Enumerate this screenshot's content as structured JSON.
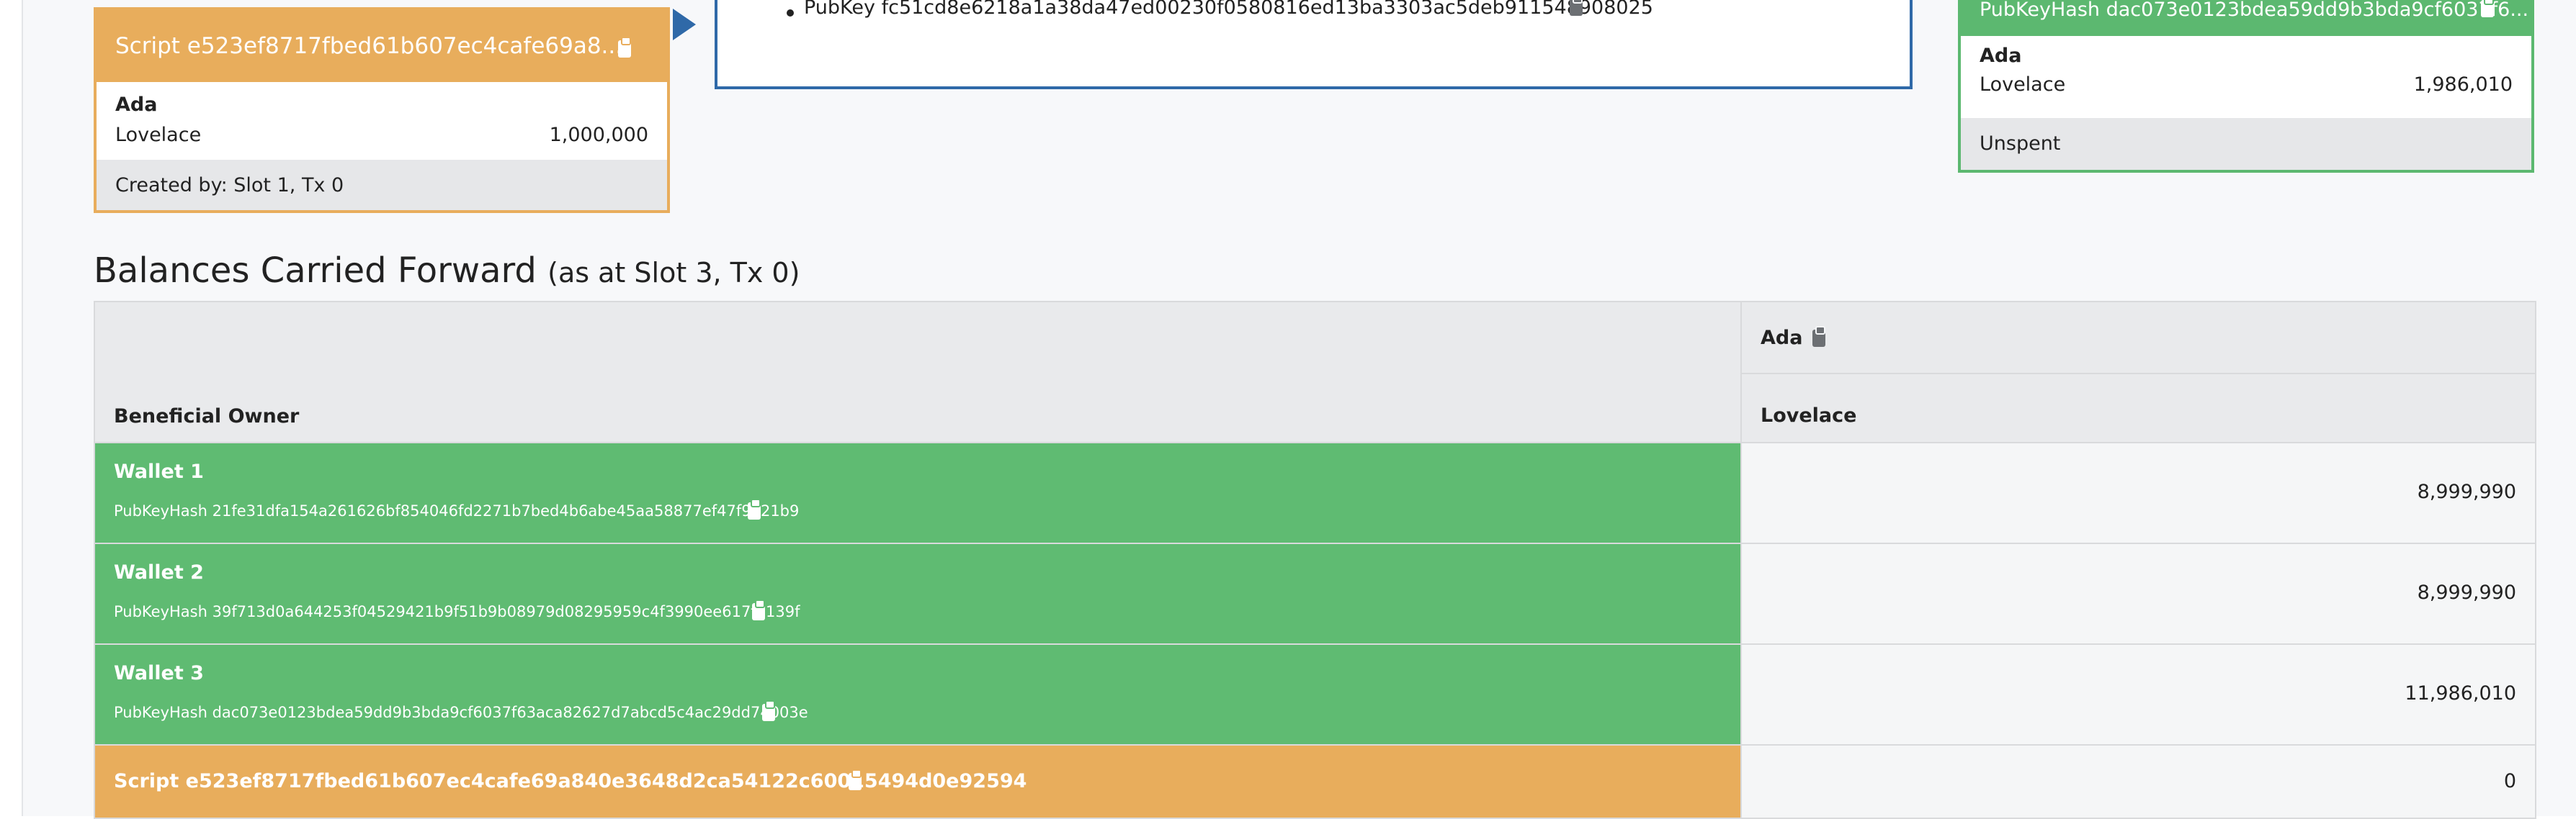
{
  "script_card": {
    "title": "Script e523ef8717fbed61b607ec4cafe69a8...",
    "currency": "Ada",
    "token": "Lovelace",
    "amount": "1,000,000",
    "footer": "Created by: Slot 1, Tx 0"
  },
  "transaction": {
    "signature": "PubKey fc51cd8e6218a1a38da47ed00230f0580816ed13ba3303ac5deb911548908025"
  },
  "wallet_card": {
    "title": "PubKeyHash dac073e0123bdea59dd9b3bda9cf6037f6...",
    "currency": "Ada",
    "token": "Lovelace",
    "amount": "1,986,010",
    "footer": "Unspent"
  },
  "balances": {
    "title": "Balances Carried Forward",
    "subtitle": "(as at Slot 3, Tx 0)",
    "owner_header": "Beneficial Owner",
    "currency_header": "Ada",
    "token_header": "Lovelace",
    "rows": [
      {
        "name": "Wallet 1",
        "key": "PubKeyHash 21fe31dfa154a261626bf854046fd2271b7bed4b6abe45aa58877ef47f9721b9",
        "value": "8,999,990"
      },
      {
        "name": "Wallet 2",
        "key": "PubKeyHash 39f713d0a644253f04529421b9f51b9b08979d08295959c4f3990ee617f5139f",
        "value": "8,999,990"
      },
      {
        "name": "Wallet 3",
        "key": "PubKeyHash dac073e0123bdea59dd9b3bda9cf6037f63aca82627d7abcd5c4ac29dd74003e",
        "value": "11,986,010"
      },
      {
        "name": "Script e523ef8717fbed61b607ec4cafe69a840e3648d2ca54122c60015494d0e92594",
        "value": "0"
      }
    ]
  },
  "colors": {
    "script": "#e8ad5c",
    "wallet": "#5fbb72",
    "transaction_border": "#2f69a8"
  },
  "icons": {
    "copy": "clipboard-icon",
    "flow": "arrow-right-icon"
  }
}
